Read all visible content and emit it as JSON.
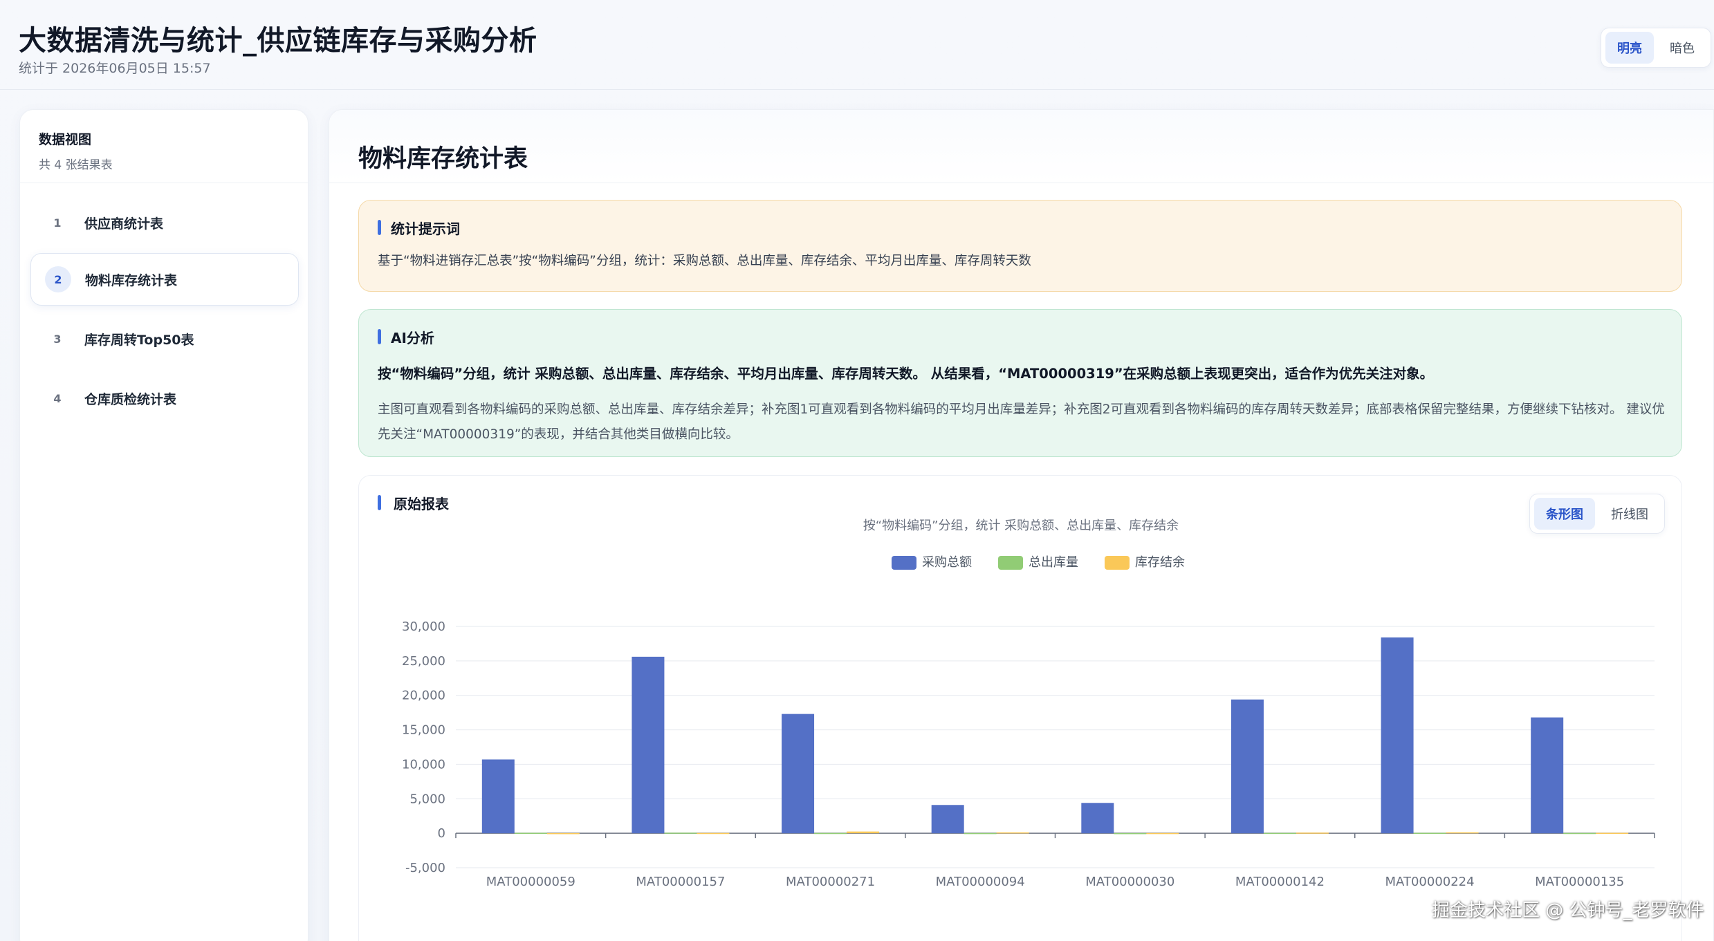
{
  "app": {
    "title": "大数据清洗与统计_供应链库存与采购分析",
    "subtitle": "统计于 2026年06月05日 15:57"
  },
  "theme": {
    "light_label": "明亮",
    "dark_label": "暗色",
    "selected": "明亮"
  },
  "sidebar": {
    "title": "数据视图",
    "count_text": "共 4 张结果表",
    "items": [
      {
        "num": "1",
        "label": "供应商统计表"
      },
      {
        "num": "2",
        "label": "物料库存统计表"
      },
      {
        "num": "3",
        "label": "库存周转Top50表"
      },
      {
        "num": "4",
        "label": "仓库质检统计表"
      }
    ],
    "active_index": 1
  },
  "main": {
    "page_title": "物料库存统计表",
    "prompt_card": {
      "title": "统计提示词",
      "text": "基于“物料进销存汇总表”按“物料编码”分组，统计：采购总额、总出库量、库存结余、平均月出库量、库存周转天数"
    },
    "ai_card": {
      "title": "AI分析",
      "highlight": "按“物料编码”分组，统计 采购总额、总出库量、库存结余、平均月出库量、库存周转天数。 从结果看，“MAT00000319”在采购总额上表现更突出，适合作为优先关注对象。",
      "detail": "主图可直观看到各物料编码的采购总额、总出库量、库存结余差异；补充图1可直观看到各物料编码的平均月出库量差异；补充图2可直观看到各物料编码的库存周转天数差异；底部表格保留完整结果，方便继续下钻核对。 建议优先关注“MAT00000319”的表现，并结合其他类目做横向比较。"
    },
    "report_card": {
      "title": "原始报表",
      "toggle": {
        "bar_label": "条形图",
        "line_label": "折线图",
        "selected": "条形图"
      }
    }
  },
  "chart_data": {
    "type": "bar",
    "title": "按“物料编码”分组，统计 采购总额、总出库量、库存结余",
    "xlabel": "",
    "ylabel": "",
    "ylim": [
      -5000,
      30000
    ],
    "yticks": [
      -5000,
      0,
      5000,
      10000,
      15000,
      20000,
      25000,
      30000
    ],
    "ytick_labels": [
      "-5,000",
      "0",
      "5,000",
      "10,000",
      "15,000",
      "20,000",
      "25,000",
      "30,000"
    ],
    "categories": [
      "MAT00000059",
      "MAT00000157",
      "MAT00000271",
      "MAT00000094",
      "MAT00000030",
      "MAT00000142",
      "MAT00000224",
      "MAT00000135"
    ],
    "series": [
      {
        "name": "采购总额",
        "color": "#5470c6",
        "values": [
          10700,
          25600,
          17300,
          4100,
          4400,
          19400,
          28400,
          16800
        ]
      },
      {
        "name": "总出库量",
        "color": "#91cc75",
        "values": [
          60,
          80,
          40,
          30,
          20,
          50,
          60,
          40
        ]
      },
      {
        "name": "库存结余",
        "color": "#fac858",
        "values": [
          20,
          40,
          250,
          120,
          30,
          90,
          130,
          60
        ]
      }
    ],
    "grid": true,
    "legend_position": "top-center"
  },
  "watermark": "掘金技术社区 @ 公钟号_老罗软件"
}
